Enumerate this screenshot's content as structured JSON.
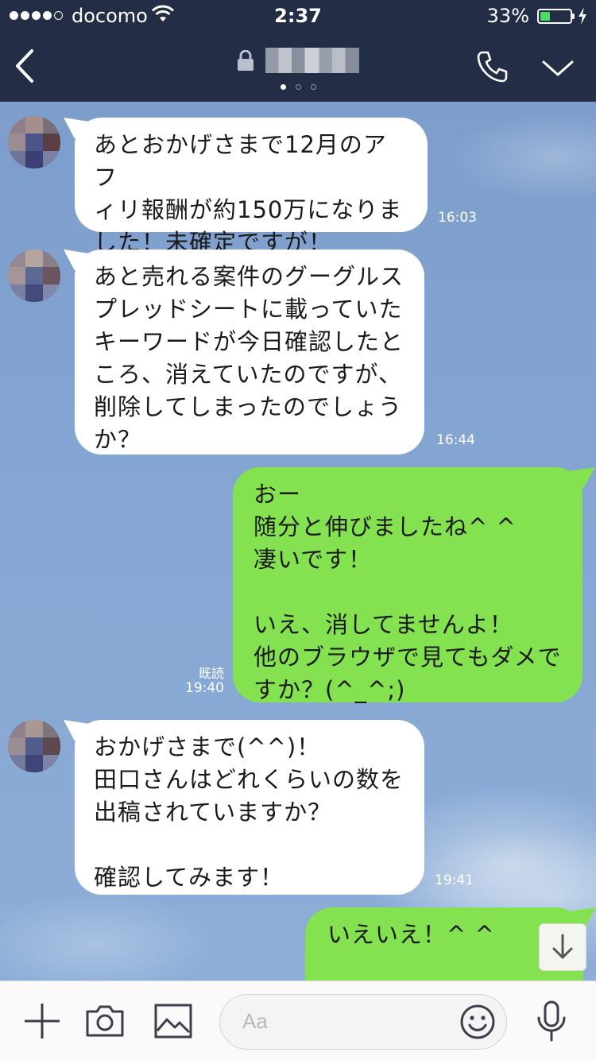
{
  "status_bar": {
    "carrier": "docomo",
    "time": "2:37",
    "battery_percent": "33%",
    "battery_level": 0.33
  },
  "header": {
    "title": "",
    "icons": [
      "back-chevron-icon",
      "lock-icon",
      "phone-icon",
      "chevron-down-icon"
    ],
    "page_dots": 3,
    "active_dot": 0
  },
  "messages": [
    {
      "side": "left",
      "text": "あとおかげさまで12月のアフ\nィリ報酬が約150万になりま\nした！未確定ですが！",
      "time": "16:03"
    },
    {
      "side": "left",
      "text": "あと売れる案件のグーグルス\nプレッドシートに載っていた\nキーワードが今日確認したと\nころ、消えていたのですが、\n削除してしまったのでしょう\nか？",
      "time": "16:44"
    },
    {
      "side": "right",
      "text": "おー\n随分と伸びましたね^ ^\n凄いです！\n\nいえ、消してませんよ！\n他のブラウザで見てもダメで\nすか？(^_^;)",
      "time": "19:40",
      "read_label": "既読"
    },
    {
      "side": "left",
      "text": "おかげさまで(^^)！\n田口さんはどれくらいの数を\n出稿されていますか？\n\n確認してみます！",
      "time": "19:41"
    },
    {
      "side": "right",
      "text": "いえいえ！^ ^"
    }
  ],
  "composer": {
    "placeholder": "Aa",
    "icons": [
      "plus-icon",
      "camera-icon",
      "image-icon",
      "smiley-icon",
      "microphone-icon"
    ]
  },
  "colors": {
    "header_bg": "#232d45",
    "incoming_bubble": "#ffffff",
    "outgoing_bubble": "#84e150",
    "chat_bg": "#7d9dcc"
  }
}
